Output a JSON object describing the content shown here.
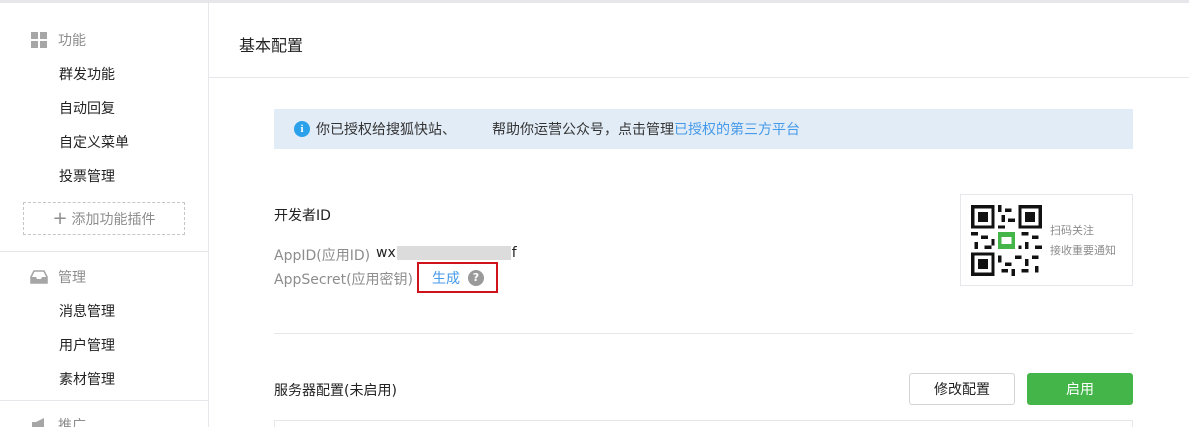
{
  "sidebar": {
    "groups": [
      {
        "title": "功能",
        "icon": "grid-icon",
        "items": [
          "群发功能",
          "自动回复",
          "自定义菜单",
          "投票管理"
        ]
      },
      {
        "title": "管理",
        "icon": "inbox-icon",
        "items": [
          "消息管理",
          "用户管理",
          "素材管理"
        ]
      },
      {
        "title": "推广",
        "icon": "megaphone-icon",
        "items": []
      }
    ],
    "add_plugin": "添加功能插件"
  },
  "page": {
    "title": "基本配置"
  },
  "notice": {
    "text_before": "你已授权给搜狐快站、",
    "text_after": "帮助你运营公众号，点击管理",
    "link": "已授权的第三方平台"
  },
  "developer": {
    "title": "开发者ID",
    "appid_label": "AppID(应用ID)",
    "appid_prefix": "wx",
    "appid_suffix": "f",
    "secret_label": "AppSecret(应用密钥)",
    "generate": "生成",
    "help": "?"
  },
  "qr": {
    "line1": "扫码关注",
    "line2": "接收重要通知"
  },
  "server": {
    "title": "服务器配置(未启用)",
    "modify_button": "修改配置",
    "enable_button": "启用"
  },
  "colors": {
    "accent": "#44b549",
    "link": "#459ae9",
    "notice_bg": "#e2ecf7",
    "highlight_border": "#d0131b"
  }
}
